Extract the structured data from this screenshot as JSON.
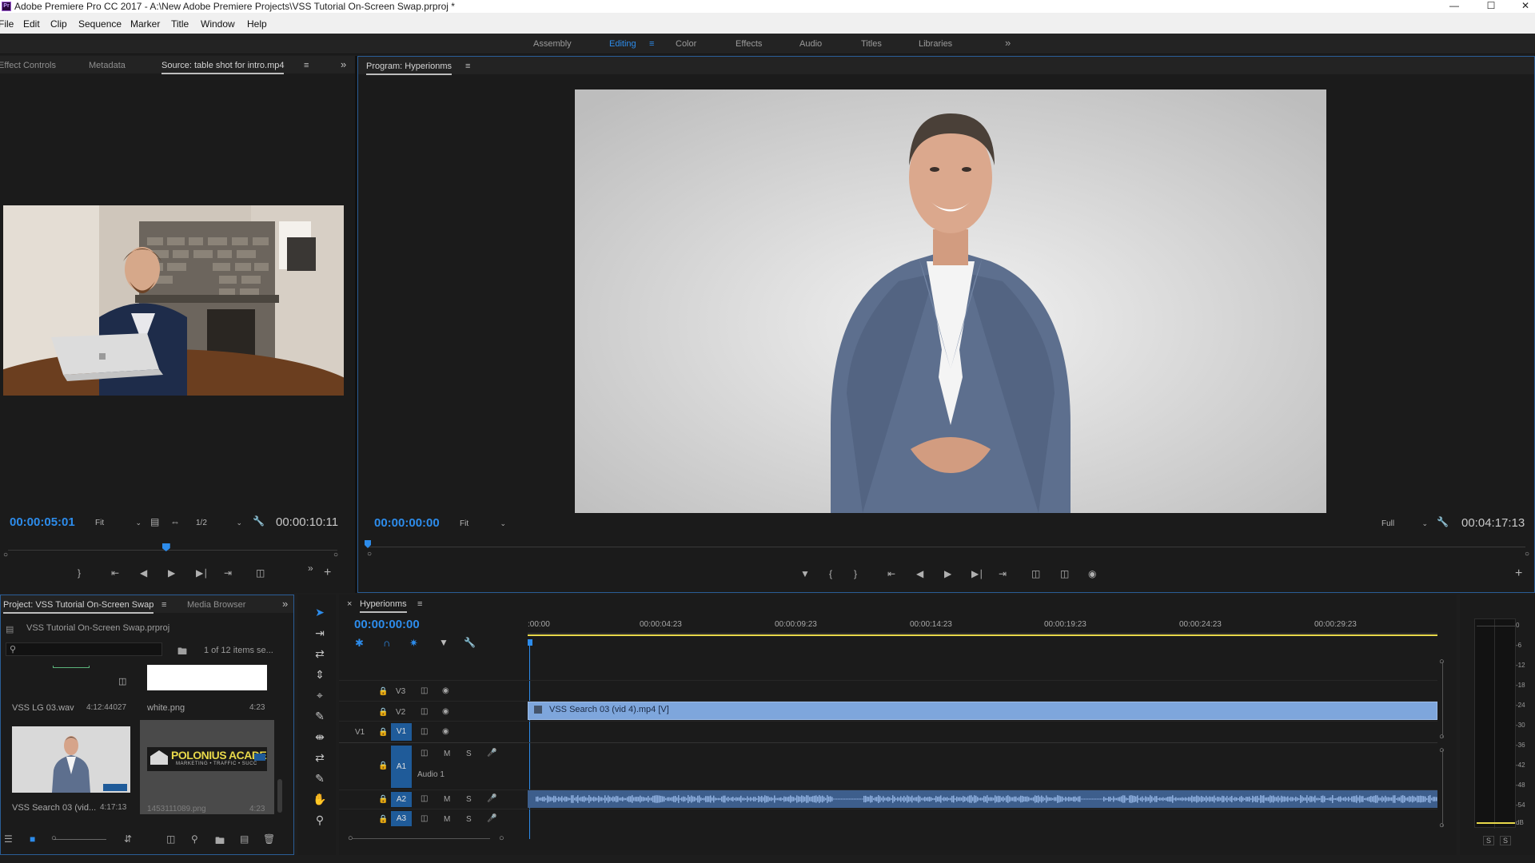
{
  "window": {
    "title": "Adobe Premiere Pro CC 2017 - A:\\New Adobe Premiere Projects\\VSS Tutorial On-Screen Swap.prproj *",
    "app_icon_label": "Pr"
  },
  "menu": [
    "File",
    "Edit",
    "Clip",
    "Sequence",
    "Marker",
    "Title",
    "Window",
    "Help"
  ],
  "workspaces": {
    "items": [
      "Assembly",
      "Editing",
      "Color",
      "Effects",
      "Audio",
      "Titles",
      "Libraries"
    ],
    "active": "Editing"
  },
  "source_panel": {
    "tabs": [
      "Effect Controls",
      "Metadata",
      "Source: table shot for intro.mp4"
    ],
    "active_tab": "Source: table shot for intro.mp4",
    "timecode": "00:00:05:01",
    "fit": "Fit",
    "resolution": "1/2",
    "duration": "00:00:10:11",
    "playhead_fraction": 0.48
  },
  "program_panel": {
    "title": "Program: Hyperionms",
    "timecode": "00:00:00:00",
    "fit": "Fit",
    "quality": "Full",
    "duration": "00:04:17:13",
    "playhead_fraction": 0.0
  },
  "project_panel": {
    "tabs": [
      "Project: VSS Tutorial On-Screen Swap",
      "Media Browser"
    ],
    "project_file": "VSS Tutorial On-Screen Swap.prproj",
    "search_placeholder": "",
    "selection_info": "1 of 12 items se...",
    "items": [
      {
        "name": "VSS LG 03.wav",
        "duration": "4:12:44027"
      },
      {
        "name": "white.png",
        "duration": "4:23"
      },
      {
        "name": "VSS Search 03 (vid...",
        "duration": "4:17:13"
      },
      {
        "name": "1453111089.png",
        "duration": "4:23",
        "logo_text": "POLONIUS ACADEMY",
        "logo_subtext": "MARKETING • TRAFFIC • SUCC"
      }
    ]
  },
  "timeline": {
    "sequence_name": "Hyperionms",
    "timecode": "00:00:00:00",
    "ruler_labels": [
      ":00:00",
      "00:00:04:23",
      "00:00:09:23",
      "00:00:14:23",
      "00:00:19:23",
      "00:00:24:23",
      "00:00:29:23"
    ],
    "video_tracks": [
      "V3",
      "V2",
      "V1"
    ],
    "source_patch": "V1",
    "audio_tracks": [
      "A1",
      "A2",
      "A3"
    ],
    "audio_track_name": "Audio 1",
    "mute_label": "M",
    "solo_label": "S",
    "clip_label": "VSS Search 03 (vid 4).mp4 [V]"
  },
  "audio_meter": {
    "labels": [
      "0",
      "-6",
      "-12",
      "-18",
      "-24",
      "-30",
      "-36",
      "-42",
      "-48",
      "-54",
      "dB"
    ],
    "solo_buttons": [
      "S",
      "S"
    ]
  },
  "colors": {
    "accent_blue": "#2d8ceb",
    "clip_blue": "#7ea6dc",
    "audio_clip": "#3d5e8c",
    "work_area": "#e8d84a"
  }
}
